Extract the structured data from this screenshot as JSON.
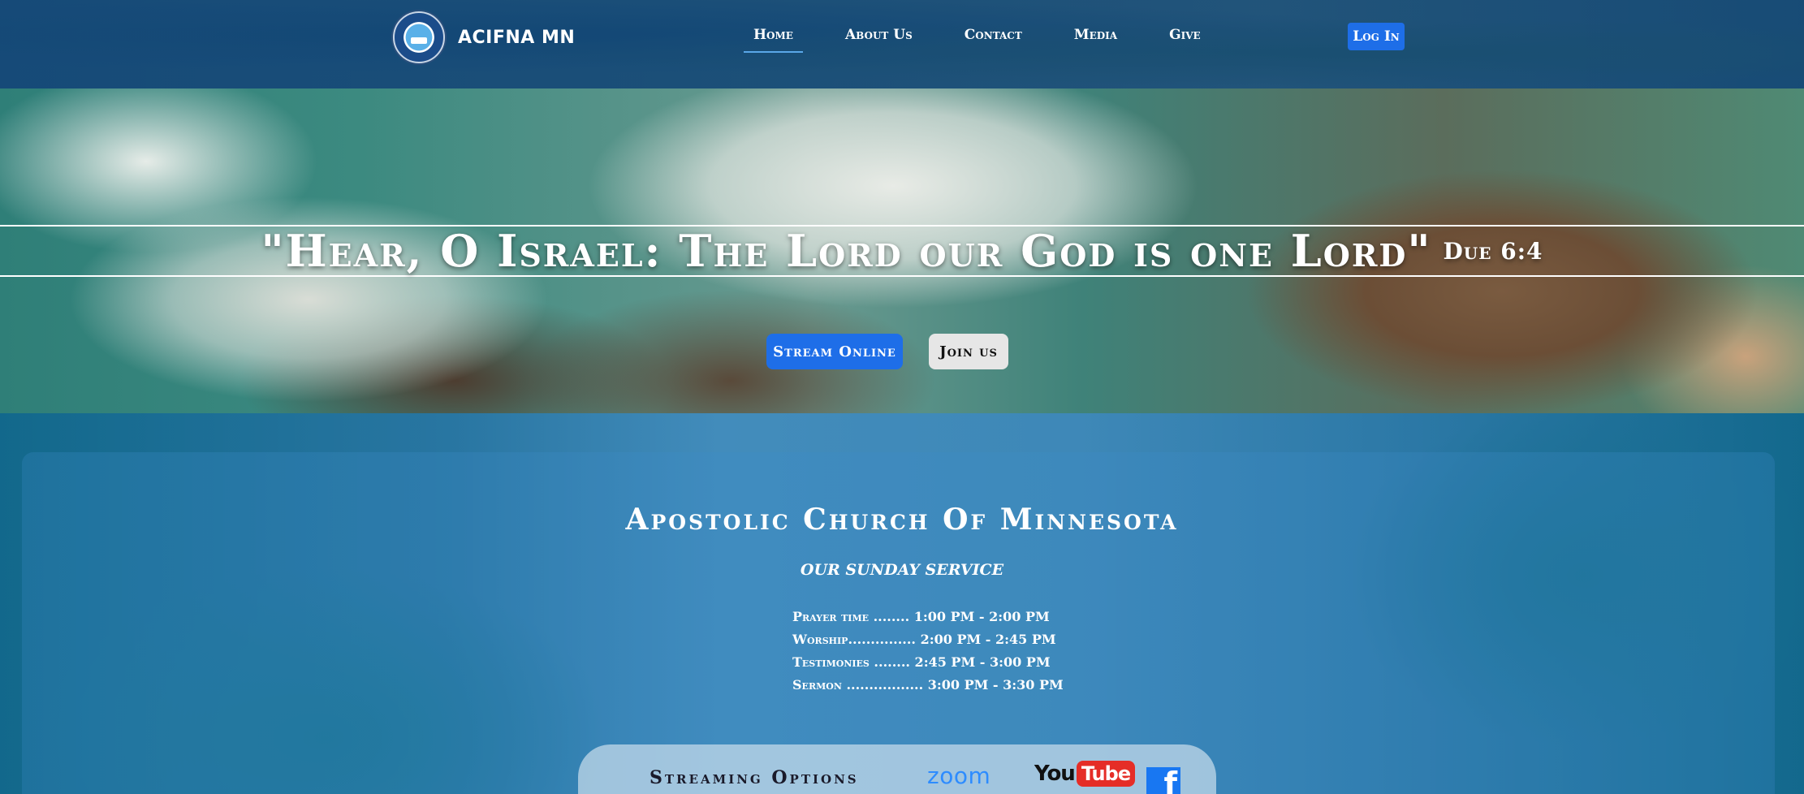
{
  "nav": {
    "brand": "ACIFNA MN",
    "links": [
      "Home",
      "About Us",
      "Contact",
      "Media",
      "Give"
    ],
    "active": "Home",
    "login": "Log In"
  },
  "hero": {
    "quote": "\"Hear, O Israel: The Lord our God is one Lord\"",
    "reference": "Due 6:4",
    "stream_button": "Stream Online",
    "join_button": "Join us"
  },
  "info": {
    "title": "Apostolic Church Of Minnesota",
    "service_title": "OUR SUNDAY SERVICE",
    "schedule": [
      "Prayer time ........ 1:00 PM - 2:00 PM",
      "Worship............... 2:00 PM - 2:45 PM",
      "Testimonies ........ 2:45 PM - 3:00 PM",
      "Sermon ................. 3:00 PM - 3:30 PM"
    ],
    "streaming_label": "Streaming Options",
    "zoom": "zoom",
    "youtube_you": "You",
    "youtube_tube": "Tube",
    "facebook": "f"
  },
  "colors": {
    "accent": "#1e6ee8",
    "nav_overlay": "#0c4678",
    "section_overlay": "#086eaf"
  },
  "icons": [
    "church-logo-icon",
    "zoom-icon",
    "youtube-icon",
    "facebook-icon"
  ]
}
